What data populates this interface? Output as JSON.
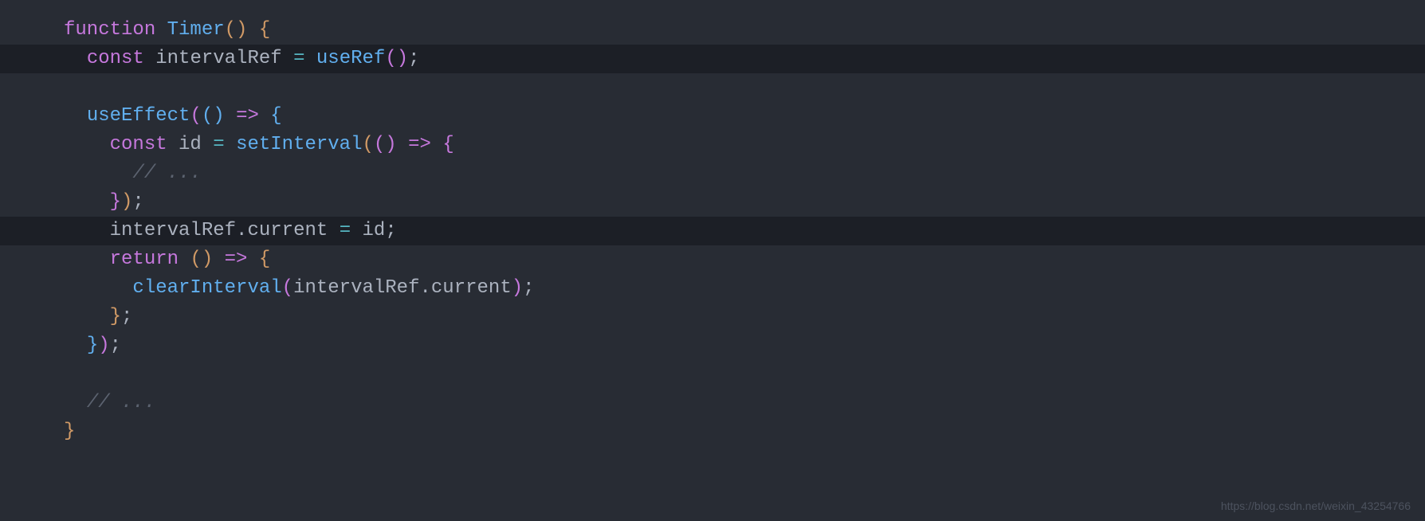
{
  "code": {
    "l1": {
      "kw": "function",
      "fn": " Timer",
      "p1": "()",
      "sp": " ",
      "br": "{"
    },
    "l2": {
      "ind": "  ",
      "kw": "const",
      "sp1": " ",
      "var": "intervalRef",
      "sp2": " ",
      "op": "=",
      "sp3": " ",
      "fn": "useRef",
      "p1": "()",
      "semi": ";"
    },
    "l4": {
      "ind": "  ",
      "fn": "useEffect",
      "p1": "(",
      "p2": "()",
      "sp": " ",
      "ar": "=>",
      "sp2": " ",
      "br": "{"
    },
    "l5": {
      "ind": "    ",
      "kw": "const",
      "sp1": " ",
      "var": "id",
      "sp2": " ",
      "op": "=",
      "sp3": " ",
      "fn": "setInterval",
      "p1": "(",
      "p2": "()",
      "sp4": " ",
      "ar": "=>",
      "sp5": " ",
      "br": "{"
    },
    "l6": {
      "ind": "      ",
      "comment": "// ..."
    },
    "l7": {
      "ind": "    ",
      "br": "}",
      "p1": ")",
      "semi": ";"
    },
    "l8": {
      "ind": "    ",
      "v1": "intervalRef",
      "dot1": ".",
      "v2": "current",
      "sp1": " ",
      "op": "=",
      "sp2": " ",
      "v3": "id",
      "semi": ";"
    },
    "l9": {
      "ind": "    ",
      "kw": "return",
      "sp1": " ",
      "p1": "()",
      "sp2": " ",
      "ar": "=>",
      "sp3": " ",
      "br": "{"
    },
    "l10": {
      "ind": "      ",
      "fn": "clearInterval",
      "p1": "(",
      "v1": "intervalRef",
      "dot1": ".",
      "v2": "current",
      "p2": ")",
      "semi": ";"
    },
    "l11": {
      "ind": "    ",
      "br": "}",
      "semi": ";"
    },
    "l12": {
      "ind": "  ",
      "br": "}",
      "p1": ")",
      "semi": ";"
    },
    "l14": {
      "ind": "  ",
      "comment": "// ..."
    },
    "l15": {
      "br": "}"
    }
  },
  "watermark": "https://blog.csdn.net/weixin_43254766"
}
